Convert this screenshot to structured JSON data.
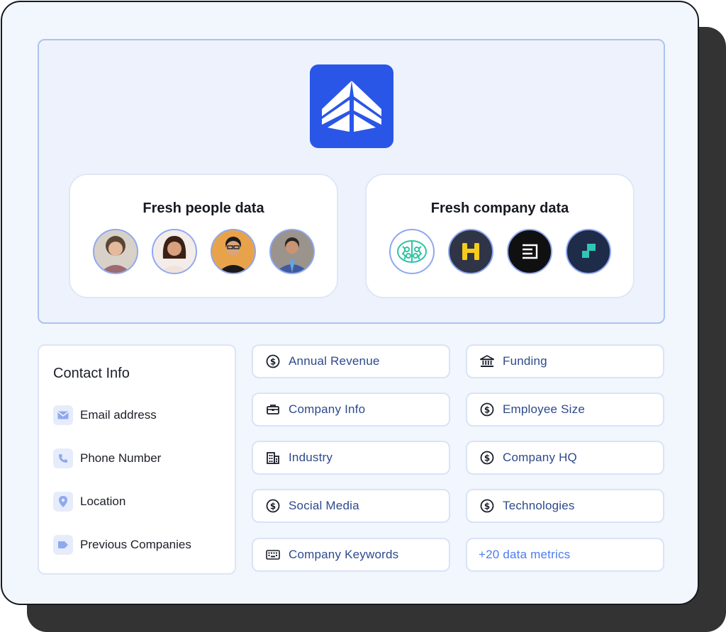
{
  "colors": {
    "brand": "#2a56e8",
    "panel_border": "#adc3f0",
    "pill_text": "#2d4a8c",
    "accent_link": "#4d7df0"
  },
  "logo": {
    "icon": "ship-bow-logo-icon"
  },
  "people_card": {
    "title": "Fresh people data",
    "avatars": [
      "woman-curly-hair-avatar",
      "woman-smiling-avatar",
      "man-glasses-avatar",
      "man-suit-avatar"
    ]
  },
  "company_card": {
    "title": "Fresh company data",
    "logos": [
      "teal-brain-logo",
      "yellow-bars-logo",
      "stacked-lines-logo",
      "teal-step-logo"
    ]
  },
  "contact_info": {
    "title": "Contact Info",
    "items": [
      {
        "label": "Email address",
        "icon": "mail-icon"
      },
      {
        "label": "Phone Number",
        "icon": "phone-icon"
      },
      {
        "label": "Location",
        "icon": "location-pin-icon"
      },
      {
        "label": "Previous Companies",
        "icon": "tag-icon"
      }
    ]
  },
  "metrics_left": [
    {
      "label": "Annual Revenue",
      "icon": "dollar-circle-icon"
    },
    {
      "label": "Company Info",
      "icon": "briefcase-icon"
    },
    {
      "label": "Industry",
      "icon": "building-icon"
    },
    {
      "label": "Social Media",
      "icon": "dollar-circle-icon"
    },
    {
      "label": "Company Keywords",
      "icon": "keyboard-icon"
    }
  ],
  "metrics_right": [
    {
      "label": "Funding",
      "icon": "bank-icon"
    },
    {
      "label": "Employee Size",
      "icon": "dollar-circle-icon"
    },
    {
      "label": "Company HQ",
      "icon": "dollar-circle-icon"
    },
    {
      "label": "Technologies",
      "icon": "dollar-circle-icon"
    }
  ],
  "more_metrics": "+20 data metrics"
}
